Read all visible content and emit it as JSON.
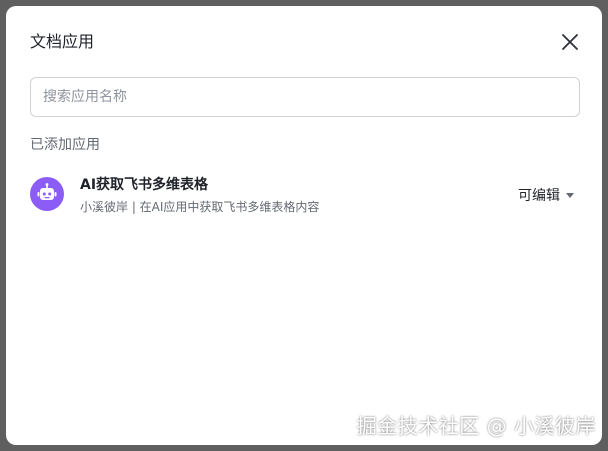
{
  "dialog": {
    "title": "文档应用",
    "search_placeholder": "搜索应用名称",
    "section_label": "已添加应用",
    "apps": [
      {
        "name": "AI获取飞书多维表格",
        "description": "小溪彼岸 | 在AI应用中获取飞书多维表格内容",
        "permission": "可编辑",
        "icon": "robot-icon"
      }
    ]
  },
  "watermark": "掘金技术社区 @ 小溪彼岸",
  "colors": {
    "avatar": "#8b5cf6",
    "text_primary": "#1f2329",
    "text_secondary": "#646a73",
    "border": "#d0d3d6"
  }
}
